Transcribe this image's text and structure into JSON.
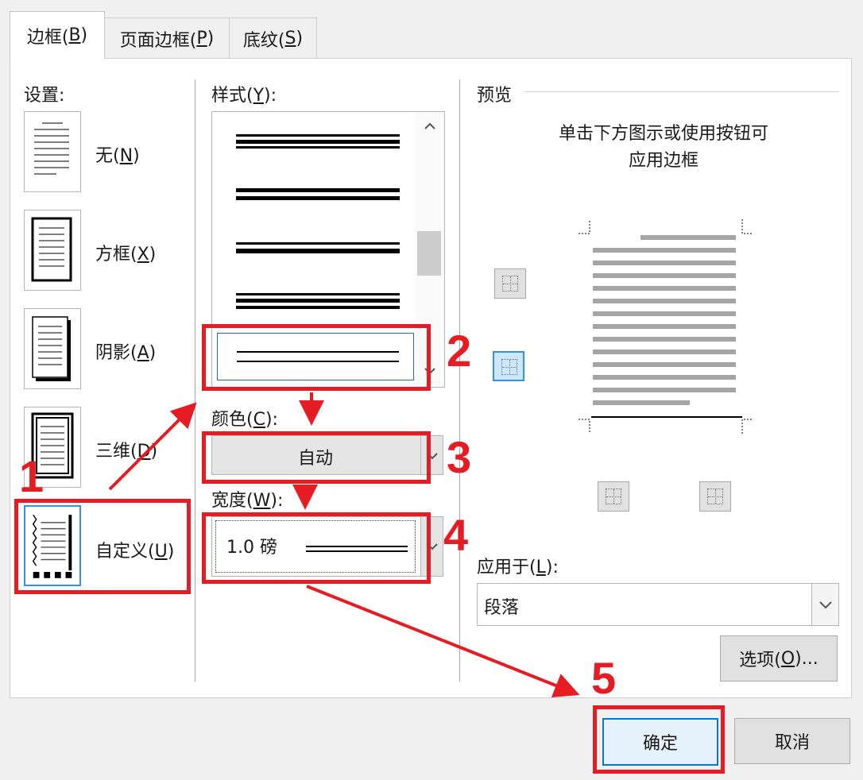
{
  "tabs": [
    {
      "label": "边框(",
      "key": "B",
      "tail": ")"
    },
    {
      "label": "页面边框(",
      "key": "P",
      "tail": ")"
    },
    {
      "label": "底纹(",
      "key": "S",
      "tail": ")"
    }
  ],
  "settings": {
    "title": "设置:",
    "items": [
      {
        "label": "无(",
        "key": "N",
        "tail": ")"
      },
      {
        "label": "方框(",
        "key": "X",
        "tail": ")"
      },
      {
        "label": "阴影(",
        "key": "A",
        "tail": ")"
      },
      {
        "label": "三维(",
        "key": "D",
        "tail": ")"
      },
      {
        "label": "自定义(",
        "key": "U",
        "tail": ")"
      }
    ]
  },
  "style": {
    "label": "样式(",
    "key": "Y",
    "tail": "):"
  },
  "color": {
    "label": "颜色(",
    "key": "C",
    "tail": "):",
    "value": "自动"
  },
  "width": {
    "label": "宽度(",
    "key": "W",
    "tail": "):",
    "value": "1.0 磅"
  },
  "preview": {
    "title": "预览",
    "hint_line1": "单击下方图示或使用按钮可",
    "hint_line2": "应用边框"
  },
  "apply_to": {
    "label": "应用于(",
    "key": "L",
    "tail": "):",
    "value": "段落"
  },
  "buttons": {
    "options": {
      "label": "选项(",
      "key": "O",
      "tail": ")..."
    },
    "ok": "确定",
    "cancel": "取消"
  },
  "annotations": [
    "1",
    "2",
    "3",
    "4",
    "5"
  ],
  "colors": {
    "annotation": "#e51c23",
    "accent": "#0078d7"
  }
}
